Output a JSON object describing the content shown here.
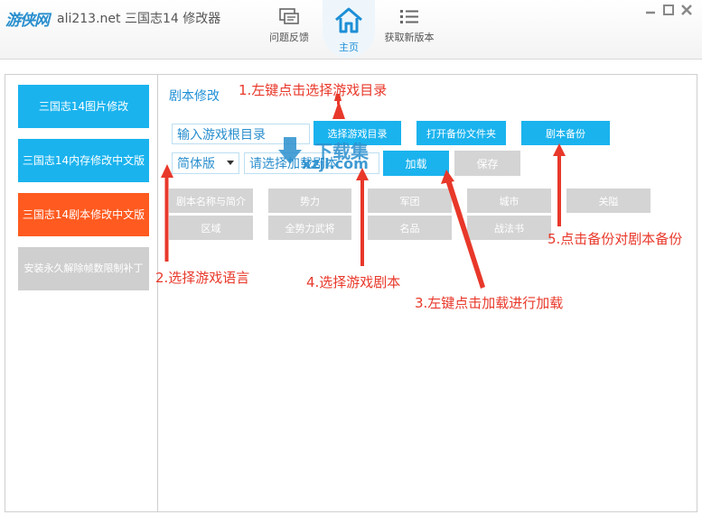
{
  "header": {
    "logo_text": "游侠网",
    "title": "ali213.net 三国志14 修改器",
    "nav": {
      "feedback": "问题反馈",
      "home": "主页",
      "update": "获取新版本"
    }
  },
  "sidebar": {
    "items": [
      {
        "label": "三国志14图片修改"
      },
      {
        "label": "三国志14内存修改中文版"
      },
      {
        "label": "三国志14剧本修改中文版"
      },
      {
        "label": "安装永久解除帧数限制补丁"
      }
    ]
  },
  "main": {
    "section_title": "剧本修改",
    "game_dir_placeholder": "输入游戏根目录",
    "select_dir_button": "选择游戏目录",
    "open_backup_folder_button": "打开备份文件夹",
    "script_backup_button": "剧本备份",
    "language_value": "简体版",
    "script_select_placeholder": "请选择加载剧本",
    "load_button": "加载",
    "save_button": "保存",
    "categories_row1": [
      "剧本名称与简介",
      "势力",
      "军团",
      "城市",
      "关隘"
    ],
    "categories_row2": [
      "区域",
      "全势力武将",
      "名品",
      "战法书"
    ]
  },
  "watermark": {
    "text": "下载集",
    "domain": "xzji.com"
  },
  "annotations": {
    "step1": "1.左键点击选择游戏目录",
    "step2": "2.选择游戏语言",
    "step3": "3.左键点击加载进行加载",
    "step4": "4.选择游戏剧本",
    "step5": "5.点击备份对剧本备份"
  },
  "colors": {
    "accent_blue": "#1ab3ee",
    "accent_orange": "#ff5a1f",
    "annotation_red": "#e8382a",
    "disabled_gray": "#d4d4d4"
  }
}
